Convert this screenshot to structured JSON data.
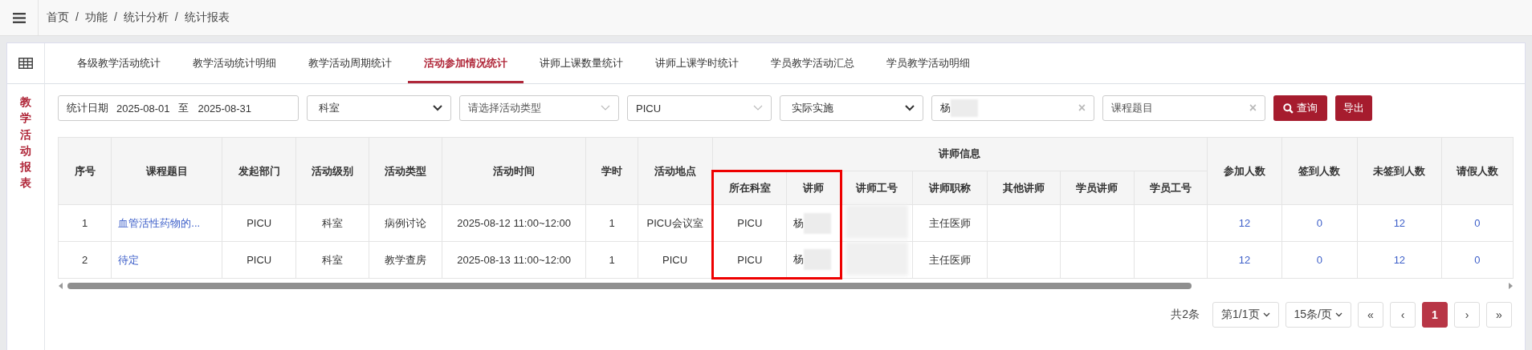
{
  "breadcrumb": [
    "首页",
    "功能",
    "统计分析",
    "统计报表"
  ],
  "breadcrumb_separator": "/",
  "sidebar": {
    "title": "教学活动报表"
  },
  "tabs": [
    {
      "label": "各级教学活动统计",
      "selected": false
    },
    {
      "label": "教学活动统计明细",
      "selected": false
    },
    {
      "label": "教学活动周期统计",
      "selected": false
    },
    {
      "label": "活动参加情况统计",
      "selected": true
    },
    {
      "label": "讲师上课数量统计",
      "selected": false
    },
    {
      "label": "讲师上课学时统计",
      "selected": false
    },
    {
      "label": "学员教学活动汇总",
      "selected": false
    },
    {
      "label": "学员教学活动明细",
      "selected": false
    }
  ],
  "filters": {
    "date_label": "统计日期",
    "date_from": "2025-08-01",
    "date_to_label": "至",
    "date_to": "2025-08-31",
    "department": "科室",
    "activity_type": {
      "placeholder": "请选择活动类型"
    },
    "unit": "PICU",
    "status": "实际实施",
    "lecturer": {
      "value": "杨",
      "redacted": true,
      "clear": "×"
    },
    "course": {
      "placeholder": "课程题目",
      "clear": "×"
    },
    "search_button": "查询",
    "export_button": "导出"
  },
  "table": {
    "columns": [
      {
        "label": "序号"
      },
      {
        "label": "课程题目"
      },
      {
        "label": "发起部门"
      },
      {
        "label": "活动级别"
      },
      {
        "label": "活动类型"
      },
      {
        "label": "活动时间"
      },
      {
        "label": "学时"
      },
      {
        "label": "活动地点"
      },
      {
        "label": "讲师信息",
        "colspan": 7,
        "children": [
          {
            "label": "所在科室",
            "highlighted": true
          },
          {
            "label": "讲师",
            "highlighted": true
          },
          {
            "label": "讲师工号",
            "highlighted": false
          },
          {
            "label": "讲师职称",
            "highlighted": false
          },
          {
            "label": "其他讲师",
            "highlighted": false
          },
          {
            "label": "学员讲师",
            "highlighted": false
          },
          {
            "label": "学员工号",
            "highlighted": false
          }
        ]
      },
      {
        "label": "参加人数"
      },
      {
        "label": "签到人数"
      },
      {
        "label": "未签到人数"
      },
      {
        "label": "请假人数"
      }
    ],
    "rows": [
      {
        "cells": [
          {
            "kind": "text",
            "text": "1"
          },
          {
            "kind": "link",
            "text": "血管活性药物的..."
          },
          {
            "kind": "text",
            "text": "PICU"
          },
          {
            "kind": "text",
            "text": "科室"
          },
          {
            "kind": "text",
            "text": "病例讨论"
          },
          {
            "kind": "text",
            "text": "2025-08-12 11:00~12:00"
          },
          {
            "kind": "text",
            "text": "1"
          },
          {
            "kind": "text",
            "text": "PICU会议室"
          },
          {
            "kind": "text",
            "text": "PICU"
          },
          {
            "kind": "redacted",
            "text": "杨"
          },
          {
            "kind": "redacted"
          },
          {
            "kind": "text",
            "text": "主任医师"
          },
          {
            "kind": "blank"
          },
          {
            "kind": "blank"
          },
          {
            "kind": "blank"
          },
          {
            "kind": "number",
            "text": "12"
          },
          {
            "kind": "number",
            "text": "0"
          },
          {
            "kind": "number",
            "text": "12"
          },
          {
            "kind": "number",
            "text": "0"
          }
        ]
      },
      {
        "cells": [
          {
            "kind": "text",
            "text": "2"
          },
          {
            "kind": "link",
            "text": "待定"
          },
          {
            "kind": "text",
            "text": "PICU"
          },
          {
            "kind": "text",
            "text": "科室"
          },
          {
            "kind": "text",
            "text": "教学查房"
          },
          {
            "kind": "text",
            "text": "2025-08-13 11:00~12:00"
          },
          {
            "kind": "text",
            "text": "1"
          },
          {
            "kind": "text",
            "text": "PICU"
          },
          {
            "kind": "text",
            "text": "PICU"
          },
          {
            "kind": "redacted",
            "text": "杨"
          },
          {
            "kind": "redacted"
          },
          {
            "kind": "text",
            "text": "主任医师"
          },
          {
            "kind": "blank"
          },
          {
            "kind": "blank"
          },
          {
            "kind": "blank"
          },
          {
            "kind": "number",
            "text": "12"
          },
          {
            "kind": "number",
            "text": "0"
          },
          {
            "kind": "number",
            "text": "12"
          },
          {
            "kind": "number",
            "text": "0"
          }
        ]
      }
    ]
  },
  "pagination": {
    "total": "共2条",
    "page": "第1/1页",
    "page_size": "15条/页",
    "first": "«",
    "prev": "‹",
    "pages": [
      {
        "label": "1",
        "selected": true
      }
    ],
    "next": "›",
    "last": "»"
  }
}
